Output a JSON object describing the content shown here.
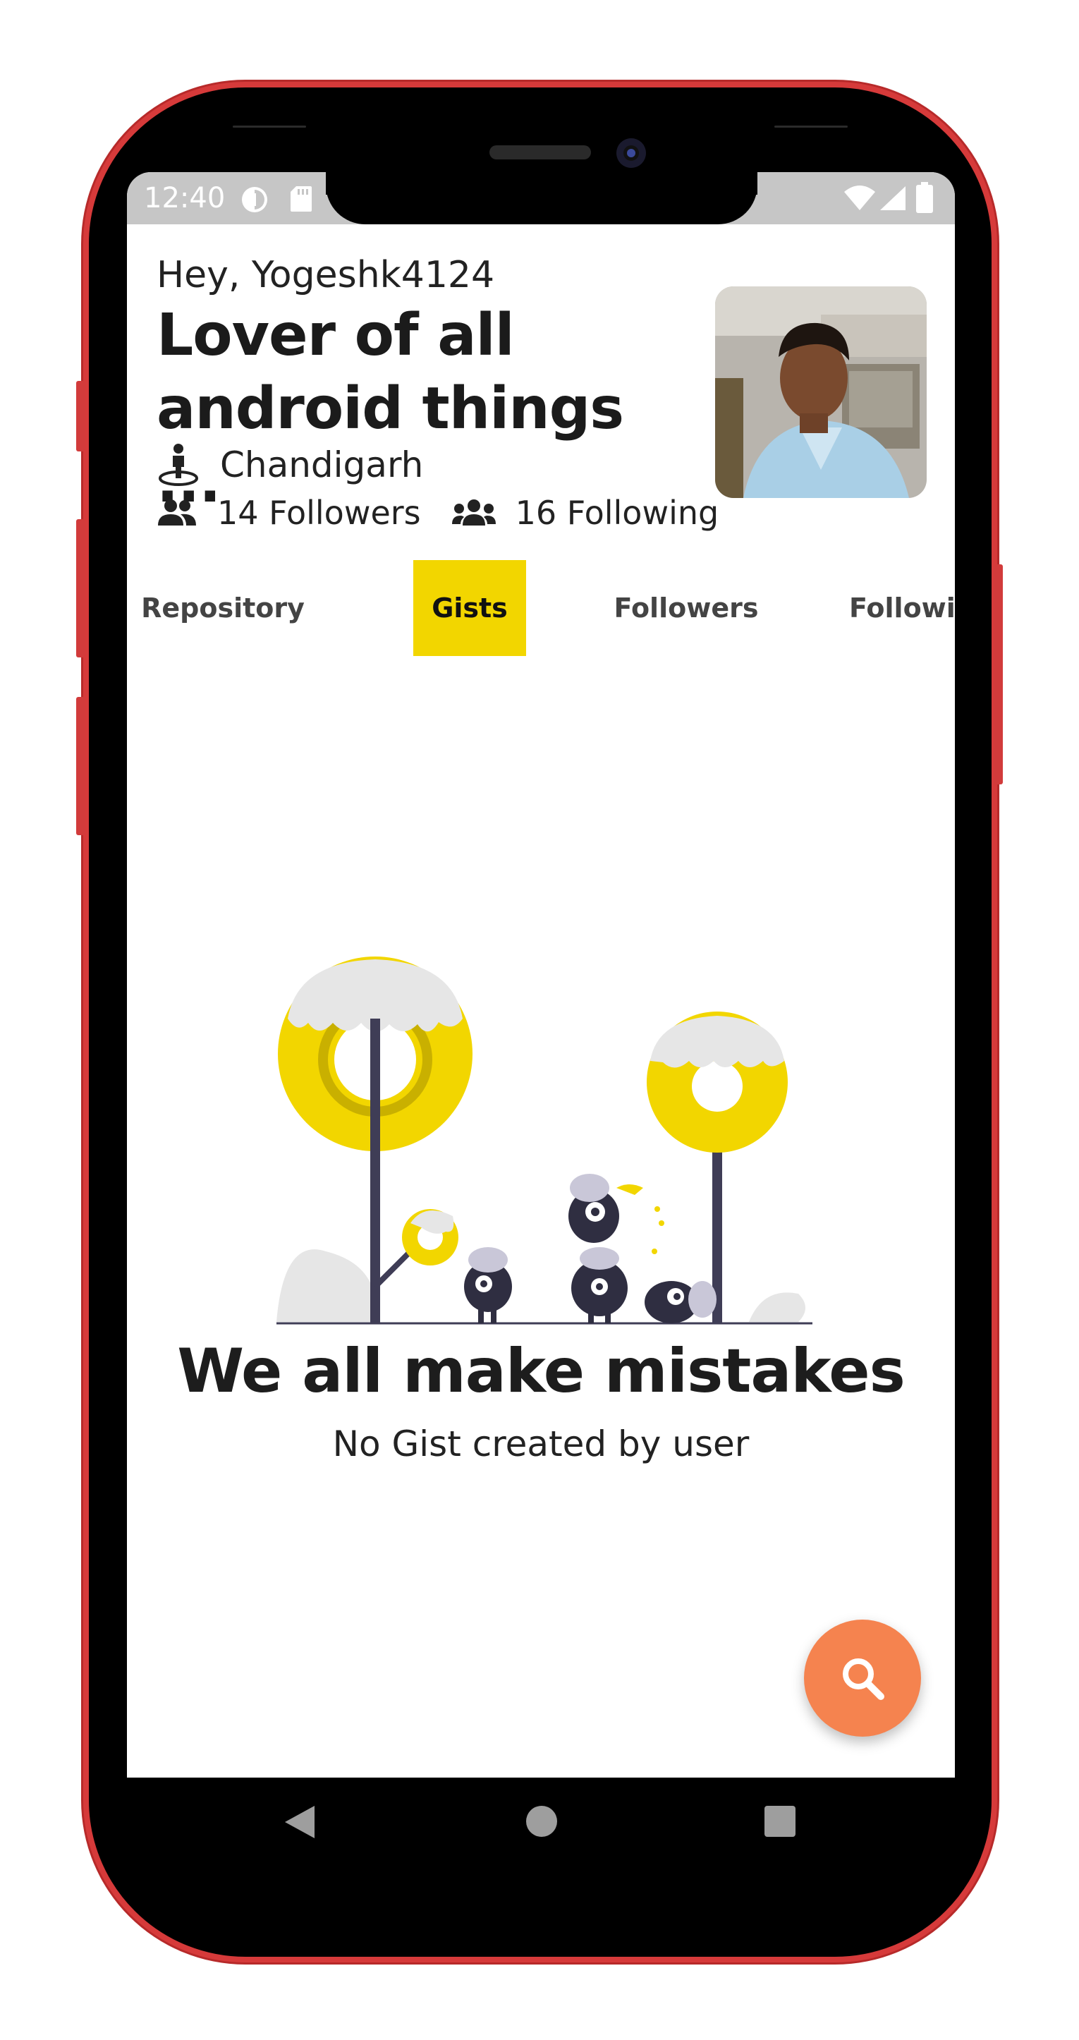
{
  "status_bar": {
    "time": "12:40",
    "left_icons": [
      "data-saver-icon",
      "sd-card-icon"
    ],
    "right_icons": [
      "wifi-icon",
      "signal-icon",
      "battery-icon"
    ]
  },
  "profile": {
    "greeting": "Hey, Yogeshk4124",
    "bio": "Lover of all android things ...",
    "location": "Chandigarh",
    "followers_text": "14 Followers",
    "following_text": "16 Following",
    "avatar_icon": "profile-photo"
  },
  "tabs": [
    {
      "label": "Repository",
      "active": false
    },
    {
      "label": "Gists",
      "active": true
    },
    {
      "label": "Followers",
      "active": false
    },
    {
      "label": "Followin",
      "active": false
    }
  ],
  "empty_state": {
    "title": "We all make mistakes",
    "subtitle": "No Gist created by user"
  },
  "fab": {
    "icon": "search-icon"
  },
  "nav": {
    "icons": [
      "back-icon",
      "home-icon",
      "recents-icon"
    ]
  },
  "colors": {
    "accent": "#f2d600",
    "fab": "#f5834f",
    "phone_frame": "#d63a3a",
    "status_bar": "#c6c6c6"
  }
}
